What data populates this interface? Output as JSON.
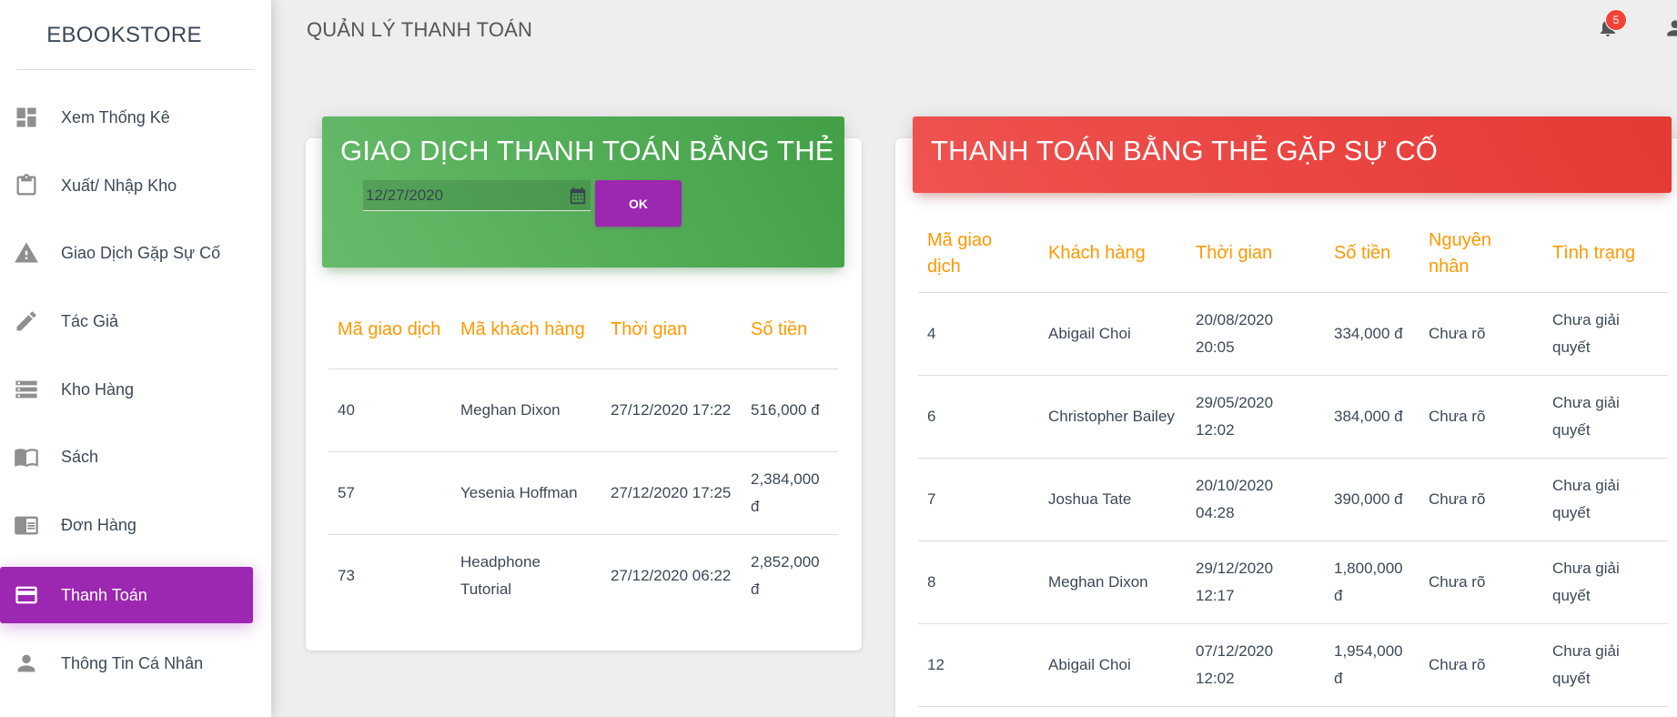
{
  "sidebar": {
    "brand": "EBOOKSTORE",
    "items": [
      {
        "label": "Xem Thống Kê",
        "icon": "dashboard-icon",
        "active": false
      },
      {
        "label": "Xuất/ Nhập Kho",
        "icon": "clipboard-icon",
        "active": false
      },
      {
        "label": "Giao Dịch Gặp Sự Cố",
        "icon": "warning-icon",
        "active": false
      },
      {
        "label": "Tác Giả",
        "icon": "pencil-icon",
        "active": false
      },
      {
        "label": "Kho Hàng",
        "icon": "storage-icon",
        "active": false
      },
      {
        "label": "Sách",
        "icon": "book-icon",
        "active": false
      },
      {
        "label": "Đơn Hàng",
        "icon": "chrome-reader-icon",
        "active": false
      },
      {
        "label": "Thanh Toán",
        "icon": "credit-card-icon",
        "active": true
      },
      {
        "label": "Thông Tin Cá Nhân",
        "icon": "person-icon",
        "active": false
      }
    ]
  },
  "header": {
    "title": "QUẢN LÝ THANH TOÁN",
    "notification_count": "5"
  },
  "card_payments": {
    "title": "GIAO DỊCH THANH TOÁN BẰNG THẺ",
    "date_value": "12/27/2020",
    "ok_label": "OK",
    "columns": [
      "Mã giao dịch",
      "Mã khách hàng",
      "Thời gian",
      "Số tiền"
    ],
    "rows": [
      [
        "40",
        "Meghan Dixon",
        "27/12/2020 17:22",
        "516,000 đ"
      ],
      [
        "57",
        "Yesenia Hoffman",
        "27/12/2020 17:25",
        "2,384,000 đ"
      ],
      [
        "73",
        "Headphone Tutorial",
        "27/12/2020 06:22",
        "2,852,000 đ"
      ]
    ]
  },
  "failed_payments": {
    "title": "THANH TOÁN BẰNG THẺ GẶP SỰ CỐ",
    "columns": [
      "Mã giao dịch",
      "Khách hàng",
      "Thời gian",
      "Số tiền",
      "Nguyên nhân",
      "Tình trạng"
    ],
    "rows": [
      [
        "4",
        "Abigail Choi",
        "20/08/2020 20:05",
        "334,000 đ",
        "Chưa rõ",
        "Chưa giải quyết"
      ],
      [
        "6",
        "Christopher Bailey",
        "29/05/2020 12:02",
        "384,000 đ",
        "Chưa rõ",
        "Chưa giải quyết"
      ],
      [
        "7",
        "Joshua Tate",
        "20/10/2020 04:28",
        "390,000 đ",
        "Chưa rõ",
        "Chưa giải quyết"
      ],
      [
        "8",
        "Meghan Dixon",
        "29/12/2020 12:17",
        "1,800,000 đ",
        "Chưa rõ",
        "Chưa giải quyết"
      ],
      [
        "12",
        "Abigail Choi",
        "07/12/2020 12:02",
        "1,954,000 đ",
        "Chưa rõ",
        "Chưa giải quyết"
      ]
    ]
  },
  "colors": {
    "active": "#9c27b0",
    "green_header": "#4caf50",
    "red_header": "#f44336",
    "table_header": "#ff9800"
  }
}
